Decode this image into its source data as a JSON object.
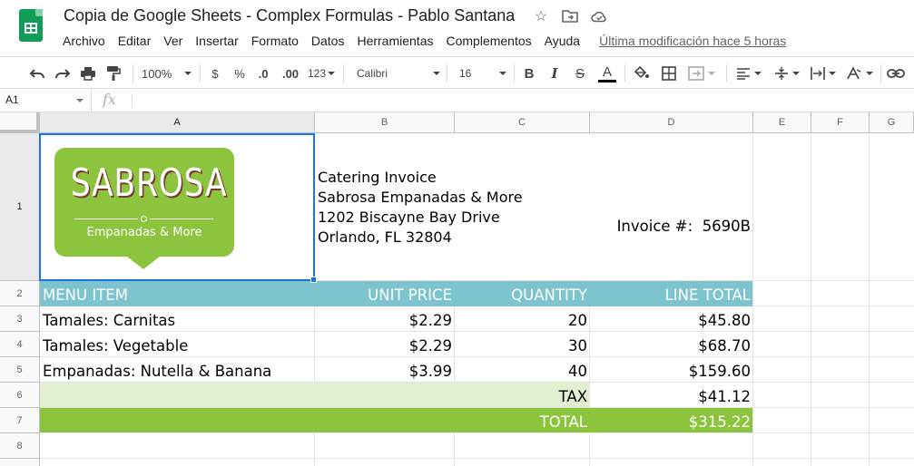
{
  "document": {
    "title": "Copia de Google Sheets - Complex Formulas - Pablo Santana",
    "last_edit": "Última modificación hace 5 horas"
  },
  "menu": [
    "Archivo",
    "Editar",
    "Ver",
    "Insertar",
    "Formato",
    "Datos",
    "Herramientas",
    "Complementos",
    "Ayuda"
  ],
  "toolbar": {
    "zoom": "100%",
    "currency": "$",
    "percent": "%",
    "decrease_decimals": ".0",
    "increase_decimals": ".00",
    "more_formats": "123",
    "font": "Calibri",
    "font_size": "16",
    "bold": "B",
    "italic": "I",
    "strikethrough": "S",
    "text_color": "A"
  },
  "formula_bar": {
    "name_box": "A1",
    "fx": "fx",
    "formula": ""
  },
  "columns": [
    "A",
    "B",
    "C",
    "D",
    "E",
    "F",
    "G"
  ],
  "rows": [
    "1",
    "2",
    "3",
    "4",
    "5",
    "6",
    "7",
    "8"
  ],
  "logo": {
    "title": "SABROSA",
    "subtitle": "Empanadas & More"
  },
  "header_info": {
    "lines": [
      "Catering Invoice",
      "Sabrosa Empanadas & More",
      "1202 Biscayne Bay Drive",
      "Orlando, FL 32804"
    ],
    "invoice_label": "Invoice #:",
    "invoice_number": "5690B"
  },
  "table": {
    "headers": [
      "MENU ITEM",
      "UNIT PRICE",
      "QUANTITY",
      "LINE TOTAL"
    ],
    "rows": [
      [
        "Tamales: Carnitas",
        "$2.29",
        "20",
        "$45.80"
      ],
      [
        "Tamales: Vegetable",
        "$2.29",
        "30",
        "$68.70"
      ],
      [
        "Empanadas: Nutella & Banana",
        "$3.99",
        "40",
        "$159.60"
      ]
    ],
    "tax_label": "TAX",
    "tax_value": "$41.12",
    "total_label": "TOTAL",
    "total_value": "$315.22"
  },
  "colors": {
    "header_band": "#7ec4cf",
    "tax_band": "#e3f0cf",
    "total_band": "#8cc43e",
    "selection": "#1a73e8"
  }
}
